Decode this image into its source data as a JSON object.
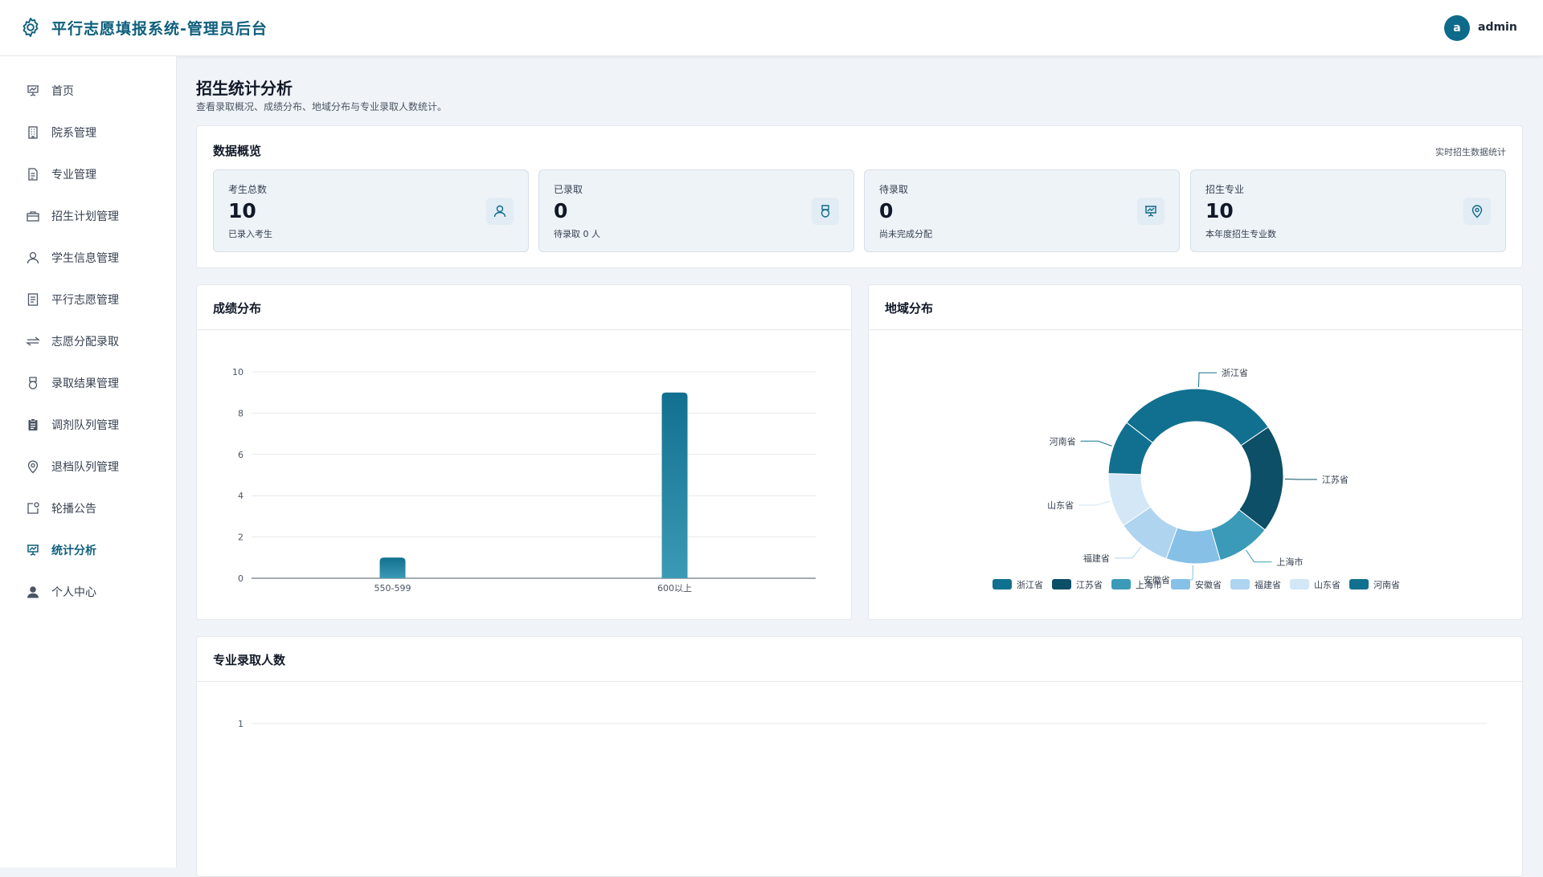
{
  "header": {
    "title": "平行志愿填报系统-管理员后台",
    "avatar_letter": "a",
    "username": "admin"
  },
  "sidebar": {
    "items": [
      {
        "label": "首页",
        "icon": "presentation-icon"
      },
      {
        "label": "院系管理",
        "icon": "building-icon"
      },
      {
        "label": "专业管理",
        "icon": "document-icon"
      },
      {
        "label": "招生计划管理",
        "icon": "briefcase-icon"
      },
      {
        "label": "学生信息管理",
        "icon": "user-icon"
      },
      {
        "label": "平行志愿管理",
        "icon": "list-document-icon"
      },
      {
        "label": "志愿分配录取",
        "icon": "switch-icon"
      },
      {
        "label": "录取结果管理",
        "icon": "medal-icon"
      },
      {
        "label": "调剂队列管理",
        "icon": "clipboard-icon"
      },
      {
        "label": "退档队列管理",
        "icon": "location-icon"
      },
      {
        "label": "轮播公告",
        "icon": "notification-icon"
      },
      {
        "label": "统计分析",
        "icon": "data-board-icon"
      },
      {
        "label": "个人中心",
        "icon": "user-filled-icon"
      }
    ],
    "active_index": 11,
    "active_color": "#0e5f7c"
  },
  "page": {
    "title": "招生统计分析",
    "subtitle": "查看录取概况、成绩分布、地域分布与专业录取人数统计。"
  },
  "overview": {
    "title": "数据概览",
    "note": "实时招生数据统计",
    "stats": [
      {
        "label": "考生总数",
        "value": "10",
        "note": "已录入考生",
        "icon": "user-icon"
      },
      {
        "label": "已录取",
        "value": "0",
        "note": "待录取 0 人",
        "icon": "medal-icon"
      },
      {
        "label": "待录取",
        "value": "0",
        "note": "尚未完成分配",
        "icon": "data-board-icon"
      },
      {
        "label": "招生专业",
        "value": "10",
        "note": "本年度招生专业数",
        "icon": "location-icon"
      }
    ]
  },
  "score_chart": {
    "title": "成绩分布"
  },
  "region_chart": {
    "title": "地域分布"
  },
  "major_chart": {
    "title": "专业录取人数"
  },
  "chart_data": [
    {
      "type": "bar",
      "title": "成绩分布",
      "categories": [
        "550-599",
        "600以上"
      ],
      "values": [
        1,
        9
      ],
      "ylim": [
        0,
        10
      ],
      "yticks": [
        0,
        2,
        4,
        6,
        8,
        10
      ],
      "grid": true,
      "colors": {
        "top": "#11708f",
        "bottom": "#3b9ab5"
      }
    },
    {
      "type": "pie",
      "title": "地域分布",
      "donut": true,
      "legend": "bottom",
      "slices": [
        {
          "label": "浙江省",
          "value": 3,
          "color": "#11708f"
        },
        {
          "label": "江苏省",
          "value": 2,
          "color": "#0c4f66"
        },
        {
          "label": "上海市",
          "value": 1,
          "color": "#3a9ab8"
        },
        {
          "label": "安徽省",
          "value": 1,
          "color": "#86c0e6"
        },
        {
          "label": "福建省",
          "value": 1,
          "color": "#aed4f0"
        },
        {
          "label": "山东省",
          "value": 1,
          "color": "#d3e7f6"
        },
        {
          "label": "河南省",
          "value": 1,
          "color": "#11708f"
        }
      ]
    },
    {
      "type": "bar",
      "title": "专业录取人数",
      "categories": [],
      "values": [],
      "yticks": [
        1
      ],
      "grid": true
    }
  ]
}
